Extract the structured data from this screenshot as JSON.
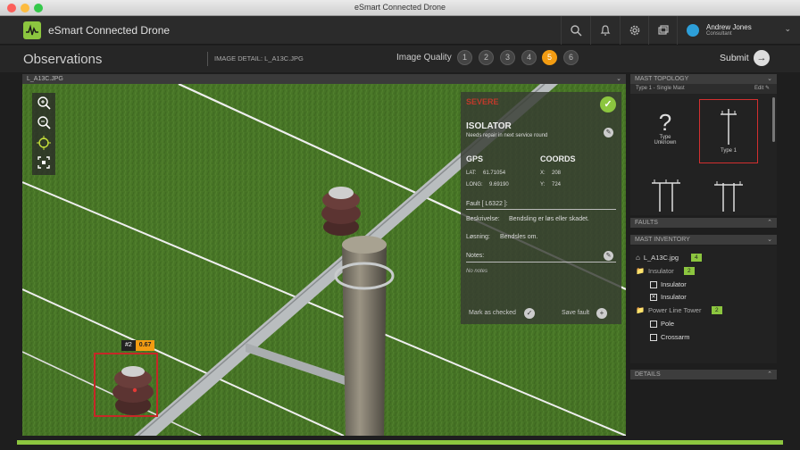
{
  "window": {
    "title": "eSmart Connected Drone"
  },
  "app": {
    "name": "eSmart Connected Drone",
    "user": {
      "name": "Andrew Jones",
      "role": "Consultant"
    }
  },
  "subbar": {
    "title": "Observations",
    "image_detail": "IMAGE DETAIL: L_A13C.JPG",
    "image_quality_label": "Image Quality",
    "quality_levels": [
      "1",
      "2",
      "3",
      "4",
      "5",
      "6"
    ],
    "selected_quality": "5",
    "submit_label": "Submit"
  },
  "viewer": {
    "filename": "L_A13C.JPG"
  },
  "panel": {
    "status": "SEVERE",
    "title": "ISOLATOR",
    "subtitle": "Needs repair in next service round",
    "gps_label": "GPS",
    "coords_label": "COORDS",
    "lat_label": "LAT:",
    "lat": "61.71054",
    "long_label": "LONG:",
    "long": "9.69190",
    "x_label": "X:",
    "x": "208",
    "y_label": "Y:",
    "y": "724",
    "fault": "Fault [ L6322 ]:",
    "beskrivelse_label": "Beskrivelse:",
    "beskrivelse": "Bendsling er løs eller skadet.",
    "losning_label": "Løsning:",
    "losning": "Bendsles om.",
    "notes_label": "Notes:",
    "notes": "No notes",
    "mark_checked": "Mark as checked",
    "save_fault": "Save fault"
  },
  "detection": {
    "id": "#2",
    "score": "0.67"
  },
  "sidebar": {
    "mast_topology": "MAST TOPOLOGY",
    "topology_desc": "Type 1 - Single Mast",
    "edit": "Edit",
    "types": [
      {
        "label_1": "Type",
        "label_2": "Unknown"
      },
      {
        "label_1": "Type 1",
        "label_2": ""
      }
    ],
    "faults": "FAULTS",
    "mast_inventory": "MAST INVENTORY",
    "inventory": {
      "file": "L_A13C.jpg",
      "file_count": "4",
      "folder1": "Insulator",
      "folder1_count": "2",
      "item1": "Insulator",
      "item2": "Insulator",
      "folder2": "Power Line Tower",
      "folder2_count": "2",
      "item3": "Pole",
      "item4": "Crossarm"
    },
    "details": "DETAILS"
  },
  "colors": {
    "accent": "#8cc63f",
    "severe": "#c0392b",
    "quality_selected": "#f39c12"
  }
}
